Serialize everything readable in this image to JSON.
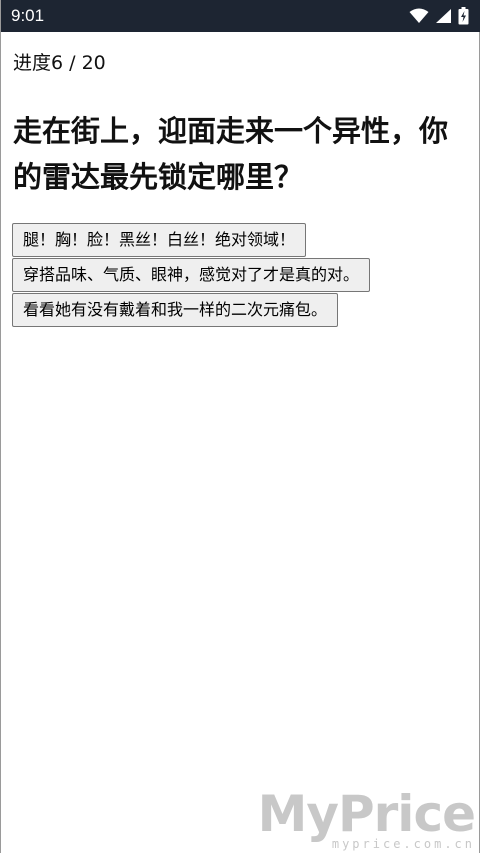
{
  "status_bar": {
    "time": "9:01",
    "icons": [
      "wifi-icon",
      "signal-icon",
      "battery-icon"
    ]
  },
  "quiz": {
    "progress": "进度6 / 20",
    "question": "走在街上，迎面走来一个异性，你的雷达最先锁定哪里？",
    "options": [
      "腿！胸！脸！黑丝！白丝！绝对领域！",
      "穿搭品味、气质、眼神，感觉对了才是真的对。",
      "看看她有没有戴着和我一样的二次元痛包。"
    ]
  },
  "watermark": {
    "logo": "MyPrice",
    "url": "myprice.com.cn"
  },
  "colors": {
    "status_bar_bg": "#1d2532",
    "button_bg": "#efefef",
    "button_border": "#767676"
  }
}
